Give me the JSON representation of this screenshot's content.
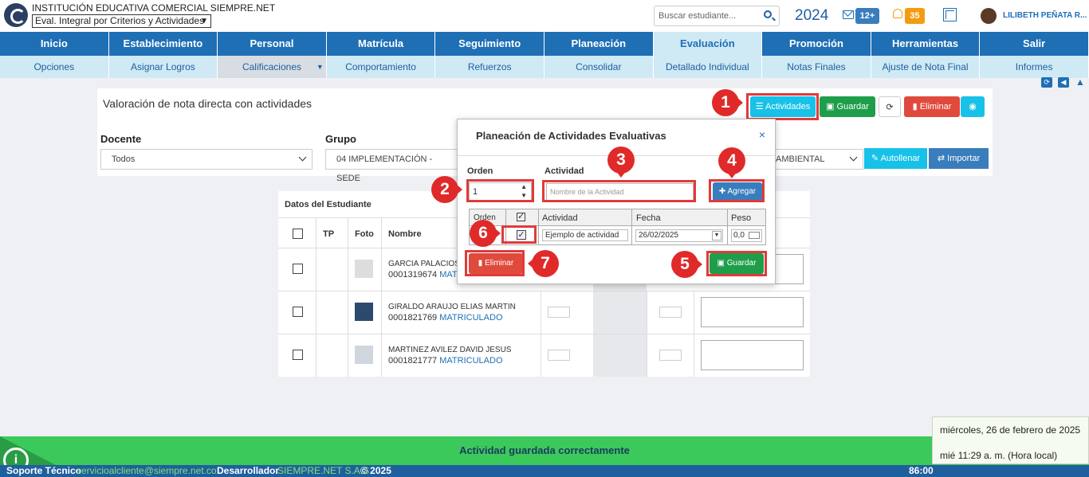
{
  "header": {
    "institution": "INSTITUCIÓN EDUCATIVA COMERCIAL SIEMPRE.NET",
    "module": "Eval. Integral por Criterios y Actividades",
    "search_placeholder": "Buscar estudiante...",
    "year": "2024",
    "mail_badge": "12+",
    "notif_badge": "35",
    "user": "LILIBETH PEÑATA R..."
  },
  "nav": {
    "main": [
      "Inicio",
      "Establecimiento",
      "Personal",
      "Matrícula",
      "Seguimiento",
      "Planeación",
      "Evaluación",
      "Promoción",
      "Herramientas",
      "Salir"
    ],
    "active_main": "Evaluación",
    "sub": [
      "Opciones",
      "Asignar Logros",
      "Calificaciones",
      "Comportamiento",
      "Refuerzos",
      "Consolidar",
      "Detallado Individual",
      "Notas Finales",
      "Ajuste de Nota Final",
      "Informes"
    ]
  },
  "panel": {
    "title": "Valoración de nota directa con actividades",
    "btn_actividades": "Actividades",
    "btn_guardar": "Guardar",
    "btn_eliminar": "Eliminar",
    "docente_label": "Docente",
    "docente_value": "Todos",
    "grupo_label": "Grupo",
    "grupo_value": "04 IMPLEMENTACIÓN - SEDE",
    "area_value": "AMBIENTAL",
    "btn_autollenar": "Autollenar",
    "btn_importar": "Importar"
  },
  "table": {
    "title": "Datos del Estudiante",
    "headers": [
      "TP",
      "Foto",
      "Nombre"
    ],
    "rows": [
      {
        "name": "GARCIA PALACIOS",
        "code": "0001319674",
        "status": "MAT"
      },
      {
        "name": "GIRALDO ARAUJO ELIAS MARTIN",
        "code": "0001821769",
        "status": "MATRICULADO"
      },
      {
        "name": "MARTINEZ AVILEZ DAVID JESUS",
        "code": "0001821777",
        "status": "MATRICULADO"
      }
    ]
  },
  "modal": {
    "title": "Planeación de Actividades Evaluativas",
    "orden_label": "Orden",
    "orden_value": "1",
    "actividad_label": "Actividad",
    "actividad_placeholder": "Nombre de la Actividad",
    "btn_agregar": "Agregar",
    "grid_headers": [
      "Orden",
      "Actividad",
      "Fecha",
      "Peso"
    ],
    "row": {
      "actividad": "Ejemplo de actividad",
      "fecha": "26/02/2025",
      "peso": "0,0"
    },
    "btn_eliminar": "Eliminar",
    "btn_guardar": "Guardar"
  },
  "callouts": [
    "1",
    "2",
    "3",
    "4",
    "5",
    "6",
    "7"
  ],
  "status": {
    "message": "Actividad guardada correctamente",
    "footer_support": "Soporte Técnico",
    "footer_email": "servicioalcliente@siempre.net.co",
    "footer_dev": "Desarrollador",
    "footer_company": "SIEMPRE.NET S.A.S",
    "footer_year": "© 2025",
    "footer_time": "86:00",
    "toast_date": "miércoles, 26 de febrero de 2025",
    "toast_time": "mié 11:29 a. m. (Hora local)"
  },
  "colors": {
    "primary": "#1f6fb5",
    "success": "#1e9e4a",
    "danger": "#e04a3c",
    "info": "#17c1e8",
    "callout": "#e02a2a"
  }
}
